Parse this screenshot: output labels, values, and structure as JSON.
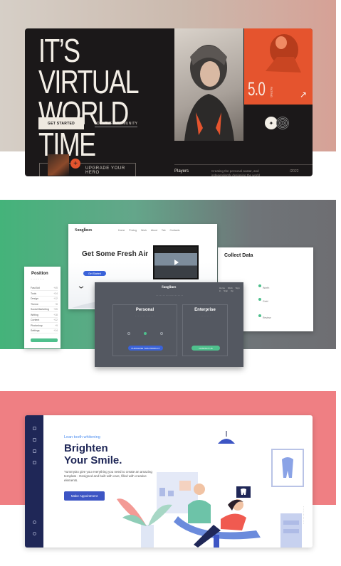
{
  "virtual_world": {
    "headline": "IT’S VIRTUAL\nWORLD TIME",
    "get_started": "GET STARTED",
    "join": "JOIN THE COMMUNITY",
    "rating": "5.0",
    "rating_sub": "RATING",
    "upgrade": "UPGRADE YOUR HERO",
    "players_label": "Players",
    "players_desc": "Creating the personal avatar, and independently designing the world",
    "year": "/2022",
    "colors": {
      "accent": "#e5542e",
      "dark": "#1b1819"
    }
  },
  "landing_kit": {
    "position": {
      "title": "Position",
      "rows": [
        {
          "label": "Fast Aid",
          "count": "+45"
        },
        {
          "label": "Tools",
          "count": "+24"
        },
        {
          "label": "Design",
          "count": "+12"
        },
        {
          "label": "Theme",
          "count": "+8"
        },
        {
          "label": "Social Marketing",
          "count": "+35"
        },
        {
          "label": "Writing",
          "count": "+18"
        },
        {
          "label": "Content",
          "count": "+22"
        },
        {
          "label": "Photoshop",
          "count": "+9"
        },
        {
          "label": "Settings",
          "count": "+14"
        }
      ]
    },
    "fresh_air": {
      "logo": "Songlines",
      "nav": "Home Pricing Work About Tab Contacts",
      "title": "Get Some Fresh Air",
      "cta": "Get Started"
    },
    "collect": {
      "title": "Collect Data",
      "items": [
        "Worth",
        "Gold",
        "Review"
      ]
    },
    "pricing": {
      "logo": "Songlines",
      "nav": "Home Work Sign in Sign Up",
      "personal_title": "Personal",
      "personal_cta": "PURCHASE THIS PRODUCT",
      "enterprise_title": "Enterprise",
      "enterprise_cta": "CONTACT US"
    }
  },
  "dental": {
    "kicker": "Lean tooth whitening",
    "headline": "Brighten\nYour Smile.",
    "body": "YummyDo give you everything you need to create an amazing template - Designed and built with care, filled with creative elements.",
    "cta": "Make Appointment"
  }
}
